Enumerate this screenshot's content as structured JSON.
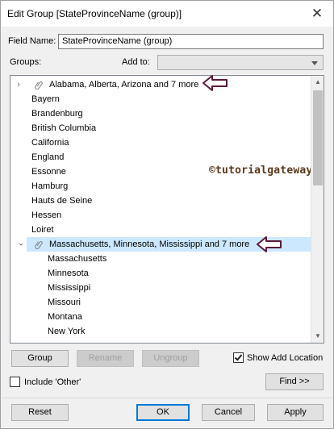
{
  "window": {
    "title": "Edit Group [StateProvinceName (group)]",
    "close_icon": "close-icon"
  },
  "field_name": {
    "label": "Field Name:",
    "value": "StateProvinceName (group)"
  },
  "groups_label": "Groups:",
  "add_to": {
    "label": "Add to:",
    "value": ""
  },
  "tree": {
    "group1": {
      "label": "Alabama, Alberta, Arizona and 7 more",
      "expanded": false,
      "icon": "paperclip-icon"
    },
    "items_top": [
      "Bayern",
      "Brandenburg",
      "British Columbia",
      "California",
      "England",
      "Essonne",
      "Hamburg",
      "Hauts de Seine",
      "Hessen",
      "Loiret"
    ],
    "group2": {
      "label": "Massachusetts, Minnesota, Mississippi and 7 more",
      "expanded": true,
      "icon": "paperclip-icon"
    },
    "group2_children": [
      "Massachusetts",
      "Minnesota",
      "Mississippi",
      "Missouri",
      "Montana",
      "New York"
    ]
  },
  "watermark": "©tutorialgateway.org",
  "buttons": {
    "group": "Group",
    "rename": "Rename",
    "ungroup": "Ungroup",
    "find": "Find >>",
    "reset": "Reset",
    "ok": "OK",
    "cancel": "Cancel",
    "apply": "Apply"
  },
  "checkboxes": {
    "show_add_location": {
      "label": "Show Add Location",
      "checked": true
    },
    "include_other": {
      "label": "Include 'Other'",
      "checked": false
    }
  },
  "colors": {
    "selection": "#cce8ff",
    "annotation_arrow": "#5b1a3a",
    "default_button_border": "#0078d7"
  }
}
